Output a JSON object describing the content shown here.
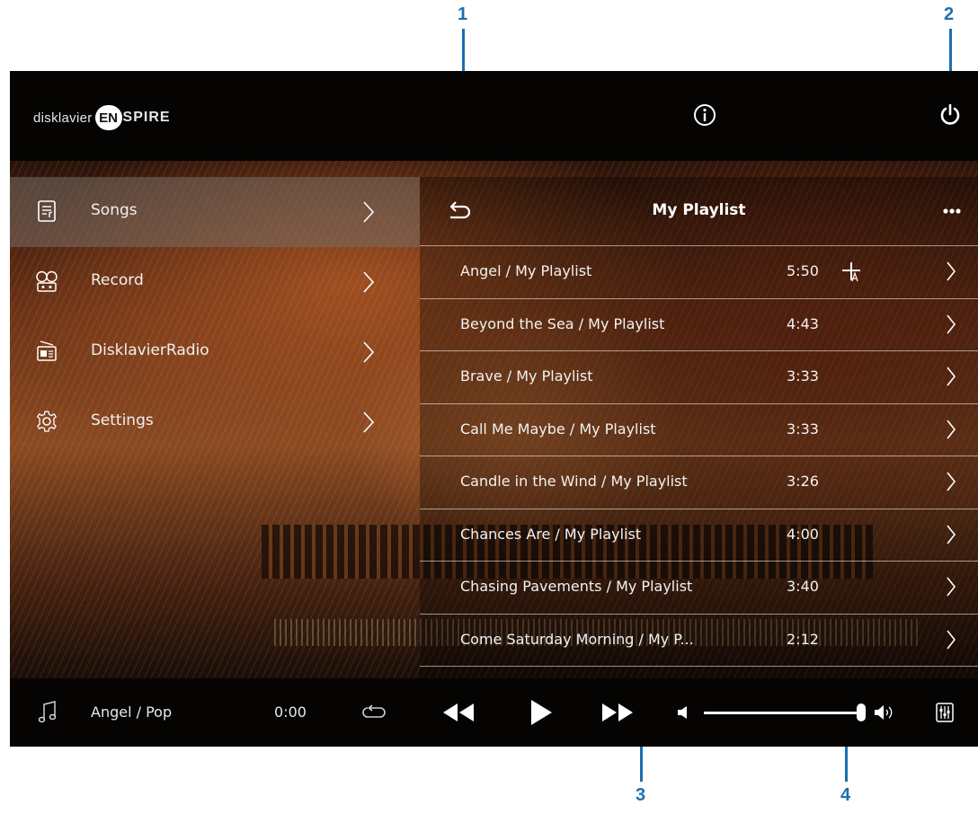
{
  "callouts": [
    "1",
    "2",
    "3",
    "4"
  ],
  "colors": {
    "callout": "#1a6fb0",
    "accent": "#ffffff",
    "selected_row": "#7a6e64"
  },
  "header": {
    "logo": {
      "prefix": "disklavier",
      "badge": "EN",
      "suffix": "SPIRE"
    },
    "icons": [
      "info-icon",
      "power-icon"
    ]
  },
  "sidebar": {
    "items": [
      {
        "label": "Songs",
        "icon": "songs-icon",
        "selected": true
      },
      {
        "label": "Record",
        "icon": "record-icon",
        "selected": false
      },
      {
        "label": "DisklavierRadio",
        "icon": "radio-icon",
        "selected": false
      },
      {
        "label": "Settings",
        "icon": "gear-icon",
        "selected": false
      }
    ]
  },
  "playlist": {
    "title": "My Playlist",
    "songs": [
      {
        "title": "Angel / My Playlist",
        "duration": "5:50",
        "has_add": true
      },
      {
        "title": "Beyond the Sea / My Playlist",
        "duration": "4:43"
      },
      {
        "title": "Brave / My Playlist",
        "duration": "3:33"
      },
      {
        "title": "Call Me Maybe / My Playlist",
        "duration": "3:33"
      },
      {
        "title": "Candle in the Wind / My Playlist",
        "duration": "3:26"
      },
      {
        "title": "Chances Are / My Playlist",
        "duration": "4:00"
      },
      {
        "title": "Chasing Pavements / My Playlist",
        "duration": "3:40"
      },
      {
        "title": "Come Saturday Morning / My P...",
        "duration": "2:12"
      }
    ]
  },
  "player": {
    "current_song": "Angel / Pop",
    "elapsed": "0:00",
    "volume": 0.97
  }
}
